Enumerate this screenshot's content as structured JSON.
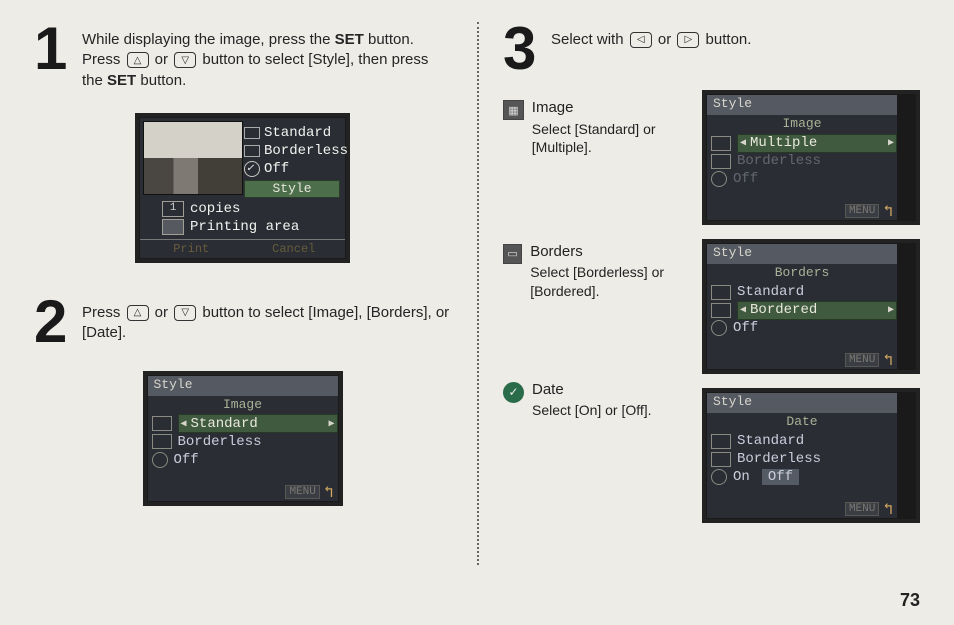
{
  "page_number": "73",
  "step1": {
    "num": "1",
    "text_a": "While displaying the image, press the ",
    "text_set1": "SET",
    "text_b": " button. Press ",
    "text_c": " or ",
    "text_d": " button to select [Style], then press the ",
    "text_set2": "SET",
    "text_e": " button.",
    "lcd": {
      "m1": "Standard",
      "m2": "Borderless",
      "m3": "Off",
      "bar": "Style",
      "copies": "copies",
      "num_copies": "1",
      "printing": "Printing area",
      "f1": "Print",
      "f2": "Cancel"
    }
  },
  "step2": {
    "num": "2",
    "text_a": "Press ",
    "text_b": " or ",
    "text_c": " button to select [Image], [Borders], or [Date].",
    "lcd": {
      "title": "Style",
      "header": "Image",
      "r1": "Standard",
      "r2": "Borderless",
      "r3": "Off",
      "menu": "MENU"
    }
  },
  "step3": {
    "num": "3",
    "text_a": "Select with ",
    "text_b": " or ",
    "text_c": " button.",
    "image": {
      "label": "Image",
      "desc": "Select [Standard] or [Multiple].",
      "lcd": {
        "title": "Style",
        "header": "Image",
        "r1": "Multiple",
        "r2": "Borderless",
        "r3": "Off",
        "menu": "MENU"
      }
    },
    "borders": {
      "label": "Borders",
      "desc": "Select [Borderless] or [Bordered].",
      "lcd": {
        "title": "Style",
        "header": "Borders",
        "r1": "Standard",
        "r2": "Bordered",
        "r3": "Off",
        "menu": "MENU"
      }
    },
    "date": {
      "label": "Date",
      "desc": "Select [On] or [Off].",
      "lcd": {
        "title": "Style",
        "header": "Date",
        "r1": "Standard",
        "r2": "Borderless",
        "r3a": "On",
        "r3b": "Off",
        "menu": "MENU"
      }
    }
  },
  "icon_up": "△",
  "icon_down": "▽",
  "icon_left": "◁",
  "icon_right": "▷"
}
